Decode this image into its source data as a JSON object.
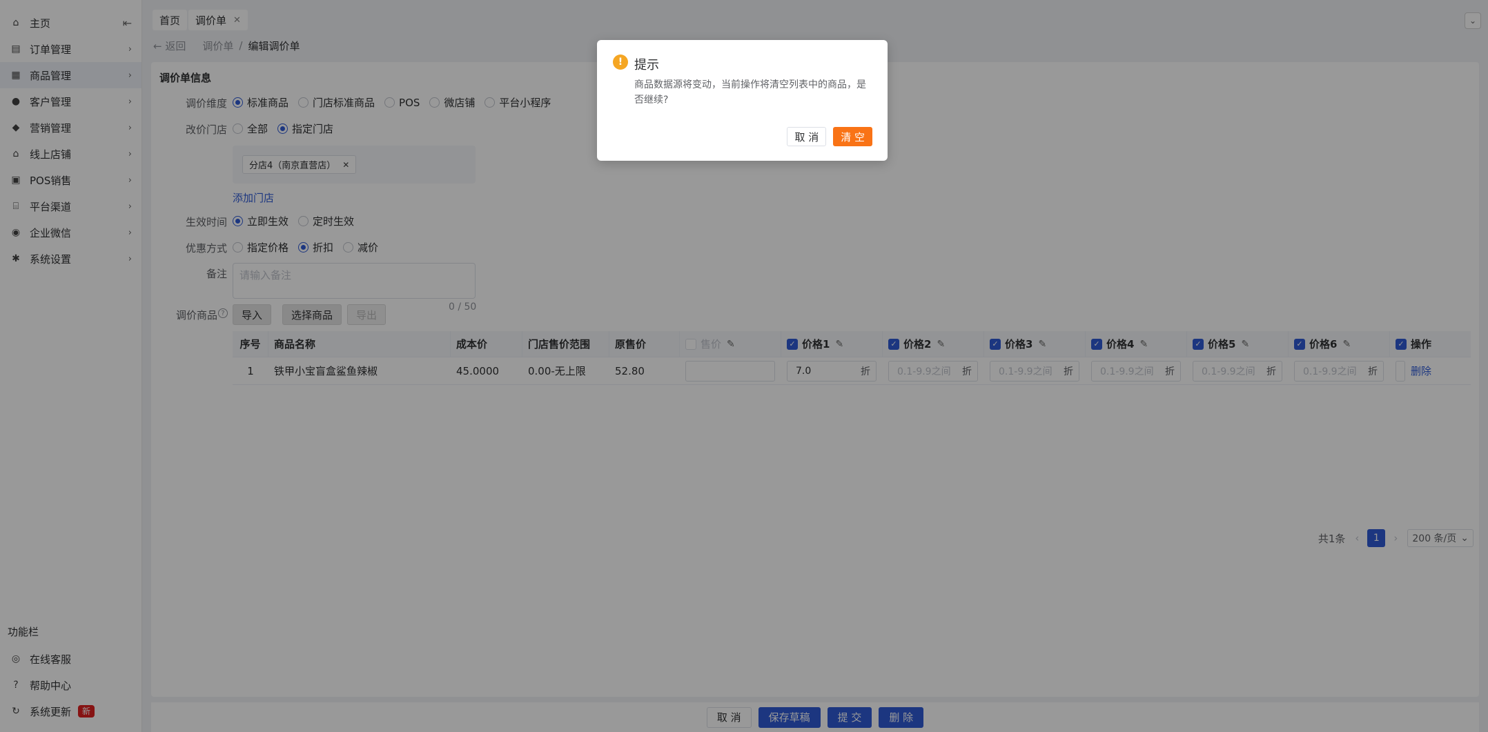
{
  "sidebar": {
    "items": [
      {
        "label": "主页",
        "icon": "home-icon"
      },
      {
        "label": "订单管理",
        "icon": "order-icon"
      },
      {
        "label": "商品管理",
        "icon": "goods-icon"
      },
      {
        "label": "客户管理",
        "icon": "user-icon"
      },
      {
        "label": "营销管理",
        "icon": "tag-icon"
      },
      {
        "label": "线上店铺",
        "icon": "store-icon"
      },
      {
        "label": "POS销售",
        "icon": "pos-icon"
      },
      {
        "label": "平台渠道",
        "icon": "channel-icon"
      },
      {
        "label": "企业微信",
        "icon": "wechat-icon"
      },
      {
        "label": "系统设置",
        "icon": "gear-icon"
      }
    ],
    "func_title": "功能栏",
    "bottom": [
      {
        "label": "在线客服",
        "icon": "service-icon"
      },
      {
        "label": "帮助中心",
        "icon": "help-icon"
      },
      {
        "label": "系统更新",
        "icon": "refresh-icon",
        "badge": "新"
      }
    ]
  },
  "tabs": {
    "home": "首页",
    "current": "调价单"
  },
  "breadcrumb": {
    "back": "返回",
    "parent": "调价单",
    "sep": "/",
    "current": "编辑调价单"
  },
  "form": {
    "section_title": "调价单信息",
    "dimension": {
      "label": "调价维度",
      "options": [
        "标准商品",
        "门店标准商品",
        "POS",
        "微店铺",
        "平台小程序"
      ],
      "selected": "标准商品"
    },
    "store": {
      "label": "改价门店",
      "options": [
        "全部",
        "指定门店"
      ],
      "selected": "指定门店",
      "tag": "分店4（南京直营店）",
      "add_link": "添加门店"
    },
    "effective": {
      "label": "生效时间",
      "options": [
        "立即生效",
        "定时生效"
      ],
      "selected": "立即生效"
    },
    "discount": {
      "label": "优惠方式",
      "options": [
        "指定价格",
        "折扣",
        "减价"
      ],
      "selected": "折扣"
    },
    "remark": {
      "label": "备注",
      "placeholder": "请输入备注",
      "counter": "0 / 50"
    },
    "goods": {
      "label": "调价商品",
      "import": "导入",
      "select": "选择商品",
      "export": "导出"
    }
  },
  "table": {
    "headers": {
      "index": "序号",
      "name": "商品名称",
      "cost": "成本价",
      "range": "门店售价范围",
      "orig": "原售价",
      "sale": "售价",
      "p1": "价格1",
      "p2": "价格2",
      "p3": "价格3",
      "p4": "价格4",
      "p5": "价格5",
      "p6": "价格6",
      "op": "操作"
    },
    "rows": [
      {
        "index": "1",
        "name": "铁甲小宝盲盒鲨鱼辣椒",
        "cost": "45.0000",
        "range": "0.00-无上限",
        "orig": "52.80",
        "sale": "",
        "p1": "7.0",
        "placeholder": "0.1-9.9之间",
        "unit": "折",
        "delete": "删除"
      }
    ]
  },
  "pager": {
    "total": "共1条",
    "page": "1",
    "size": "200 条/页"
  },
  "footer": {
    "cancel": "取 消",
    "save": "保存草稿",
    "submit": "提 交",
    "delete": "删 除"
  },
  "dialog": {
    "title": "提示",
    "message": "商品数据源将变动，当前操作将清空列表中的商品，是否继续?",
    "cancel": "取 消",
    "confirm": "清 空"
  },
  "colors": {
    "primary": "#2f5bd6",
    "warning": "#f5a623",
    "confirm": "#f97316"
  }
}
